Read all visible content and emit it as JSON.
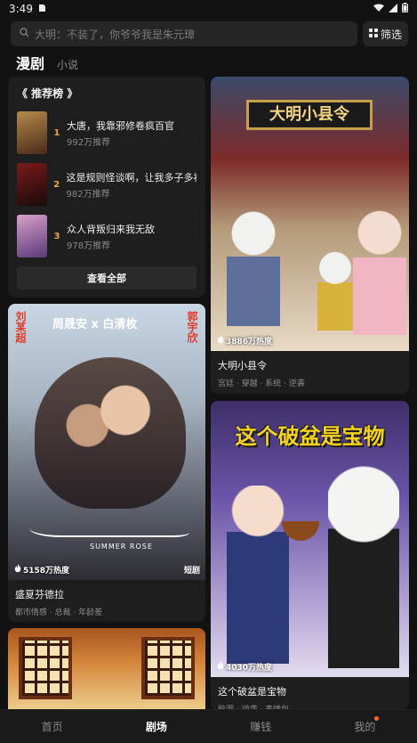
{
  "status": {
    "time": "3:49"
  },
  "search": {
    "placeholder": "大明：不装了，你爷爷我是朱元璋",
    "filter_label": "筛选"
  },
  "tabs": [
    {
      "label": "漫剧"
    },
    {
      "label": "小说"
    }
  ],
  "ranking": {
    "title": "《 推荐榜 》",
    "items": [
      {
        "rank": "1",
        "name": "大唐，我靠邪修卷疯百官",
        "count": "992万推荐"
      },
      {
        "rank": "2",
        "name": "这是规则怪谈啊，让我多子多福",
        "count": "982万推荐"
      },
      {
        "rank": "3",
        "name": "众人背叛归来我无敌",
        "count": "978万推荐"
      }
    ],
    "see_all": "查看全部"
  },
  "cards": {
    "daming": {
      "name": "大明小县令",
      "tags": "宫廷 · 穿越 · 系统 · 逆袭",
      "heat": "3886万热度",
      "poster_title": "大明小县令"
    },
    "shengxia": {
      "name": "盛夏芬德拉",
      "tags": "都市情感 · 总裁 · 年龄差",
      "heat": "5158万热度",
      "badge": "短剧",
      "poster_cast_left": "刘某超",
      "poster_cast_main": "周晟安 x 白清枚",
      "poster_cast_right": "郭宇欣",
      "poster_title_en": "SUMMER ROSE"
    },
    "pobao": {
      "name": "这个破盆是宝物",
      "tags": "脑洞 · 逆袭 · 表情包",
      "heat": "4030万热度",
      "poster_title": "这个破盆是宝物"
    }
  },
  "nav": [
    {
      "label": "首页"
    },
    {
      "label": "剧场"
    },
    {
      "label": "赚钱"
    },
    {
      "label": "我的"
    }
  ]
}
